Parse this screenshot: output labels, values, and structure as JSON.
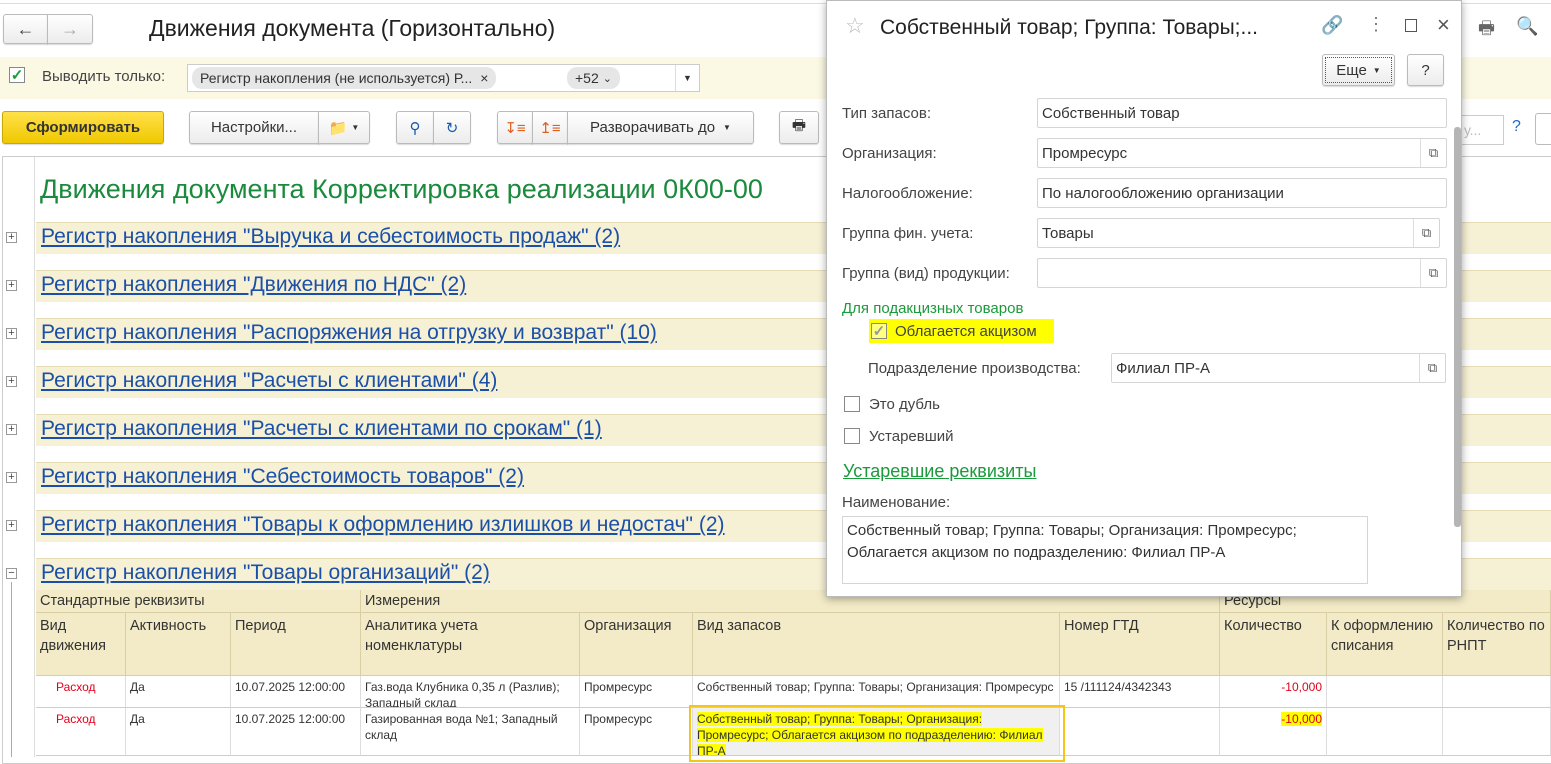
{
  "window": {
    "title": "Движения документа (Горизонтально)"
  },
  "filter": {
    "checked": true,
    "label": "Выводить только:",
    "tag": "Регистр накопления (не используется) Р...",
    "more": "+52"
  },
  "toolbar": {
    "generate": "Сформировать",
    "settings": "Настройки...",
    "expand": "Разворачивать до"
  },
  "report": {
    "title": "Движения документа Корректировка реализации 0К00-00",
    "registers": [
      "Регистр накопления \"Выручка и себестоимость продаж\" (2)",
      "Регистр накопления \"Движения по НДС\" (2)",
      "Регистр накопления \"Распоряжения на отгрузку и возврат\" (10)",
      "Регистр накопления \"Расчеты с клиентами\" (4)",
      "Регистр накопления \"Расчеты с клиентами по срокам\" (1)",
      "Регистр накопления \"Себестоимость товаров\" (2)",
      "Регистр накопления \"Товары к оформлению излишков и недостач\" (2)",
      "Регистр накопления \"Товары организаций\" (2)"
    ],
    "groups": [
      "Стандартные реквизиты",
      "Измерения",
      "Ресурсы"
    ],
    "columns": [
      "Вид движения",
      "Активность",
      "Период",
      "Аналитика учета номенклатуры",
      "Организация",
      "Вид запасов",
      "Номер ГТД",
      "Количество",
      "К оформлению списания",
      "Количество по РНПТ"
    ],
    "rows": [
      [
        "Расход",
        "Да",
        "10.07.2025 12:00:00",
        "Газ.вода Клубника 0,35 л (Разлив); Западный склад",
        "Промресурс",
        "Собственный товар; Группа: Товары; Организация: Промресурс",
        "15      /111124/4342343",
        "-10,000",
        "",
        ""
      ],
      [
        "Расход",
        "Да",
        "10.07.2025 12:00:00",
        "Газированная вода №1; Западный склад",
        "Промресурс",
        "Собственный товар; Группа: Товары; Организация: Промресурс; Облагается акцизом по подразделению: Филиал ПР-А",
        "",
        "-10,000",
        "",
        ""
      ]
    ]
  },
  "popup": {
    "title": "Собственный товар; Группа: Товары;...",
    "more": "Еще",
    "help": "?",
    "fields": [
      {
        "label": "Тип запасов:",
        "value": "Собственный товар"
      },
      {
        "label": "Организация:",
        "value": "Промресурс"
      },
      {
        "label": "Налогообложение:",
        "value": "По налогообложению организации"
      },
      {
        "label": "Группа фин. учета:",
        "value": "Товары"
      },
      {
        "label": "Группа (вид) продукции:",
        "value": ""
      }
    ],
    "excise_group": "Для подакцизных товаров",
    "excise_checkbox": "Облагается акцизом",
    "excise_checked": true,
    "division_label": "Подразделение производства:",
    "division_value": "Филиал ПР-А",
    "duplicate": "Это дубль",
    "obsolete": "Устаревший",
    "obsolete_link": "Устаревшие реквизиты",
    "name_label": "Наименование:",
    "name_value": "Собственный товар; Группа: Товары; Организация: Промресурс; Облагается акцизом по подразделению: Филиал ПР-А"
  },
  "colors": {
    "accent_green": "#1a8a3c",
    "link": "#1a50a8",
    "negative": "#e0001a",
    "highlight": "#ffff00",
    "generate_button": "#f5d200"
  }
}
